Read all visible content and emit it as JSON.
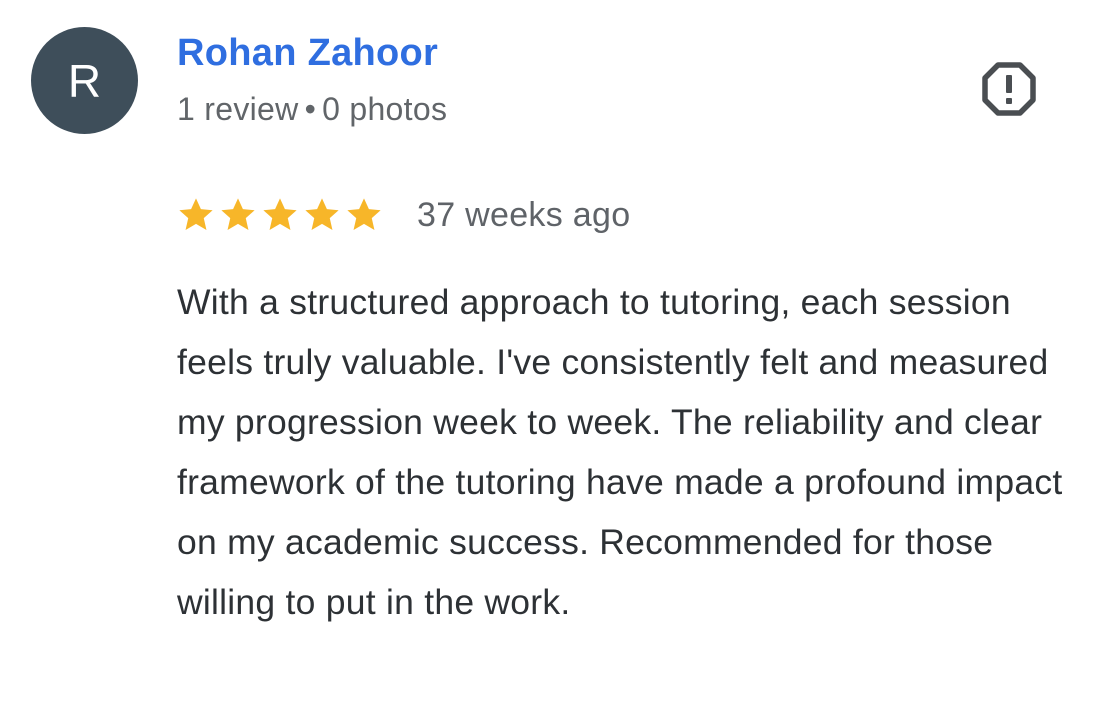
{
  "reviewer": {
    "initial": "R",
    "name": "Rohan Zahoor",
    "reviews_count": "1 review",
    "separator": "•",
    "photos_count": "0 photos",
    "avatar_color": "#3e4e5a",
    "name_color": "#2f6ee0"
  },
  "report": {
    "icon": "report-flag-icon"
  },
  "rating": {
    "stars": 5,
    "max_stars": 5,
    "star_color": "#f7b629",
    "time_ago": "37 weeks ago"
  },
  "review": {
    "text": "With a structured approach to tutoring, each session feels truly valuable. I've consistently felt and measured my progression week to week. The reliability and clear framework of the tutoring have made a profound impact on my academic success. Recommended for those willing to put in the work."
  }
}
